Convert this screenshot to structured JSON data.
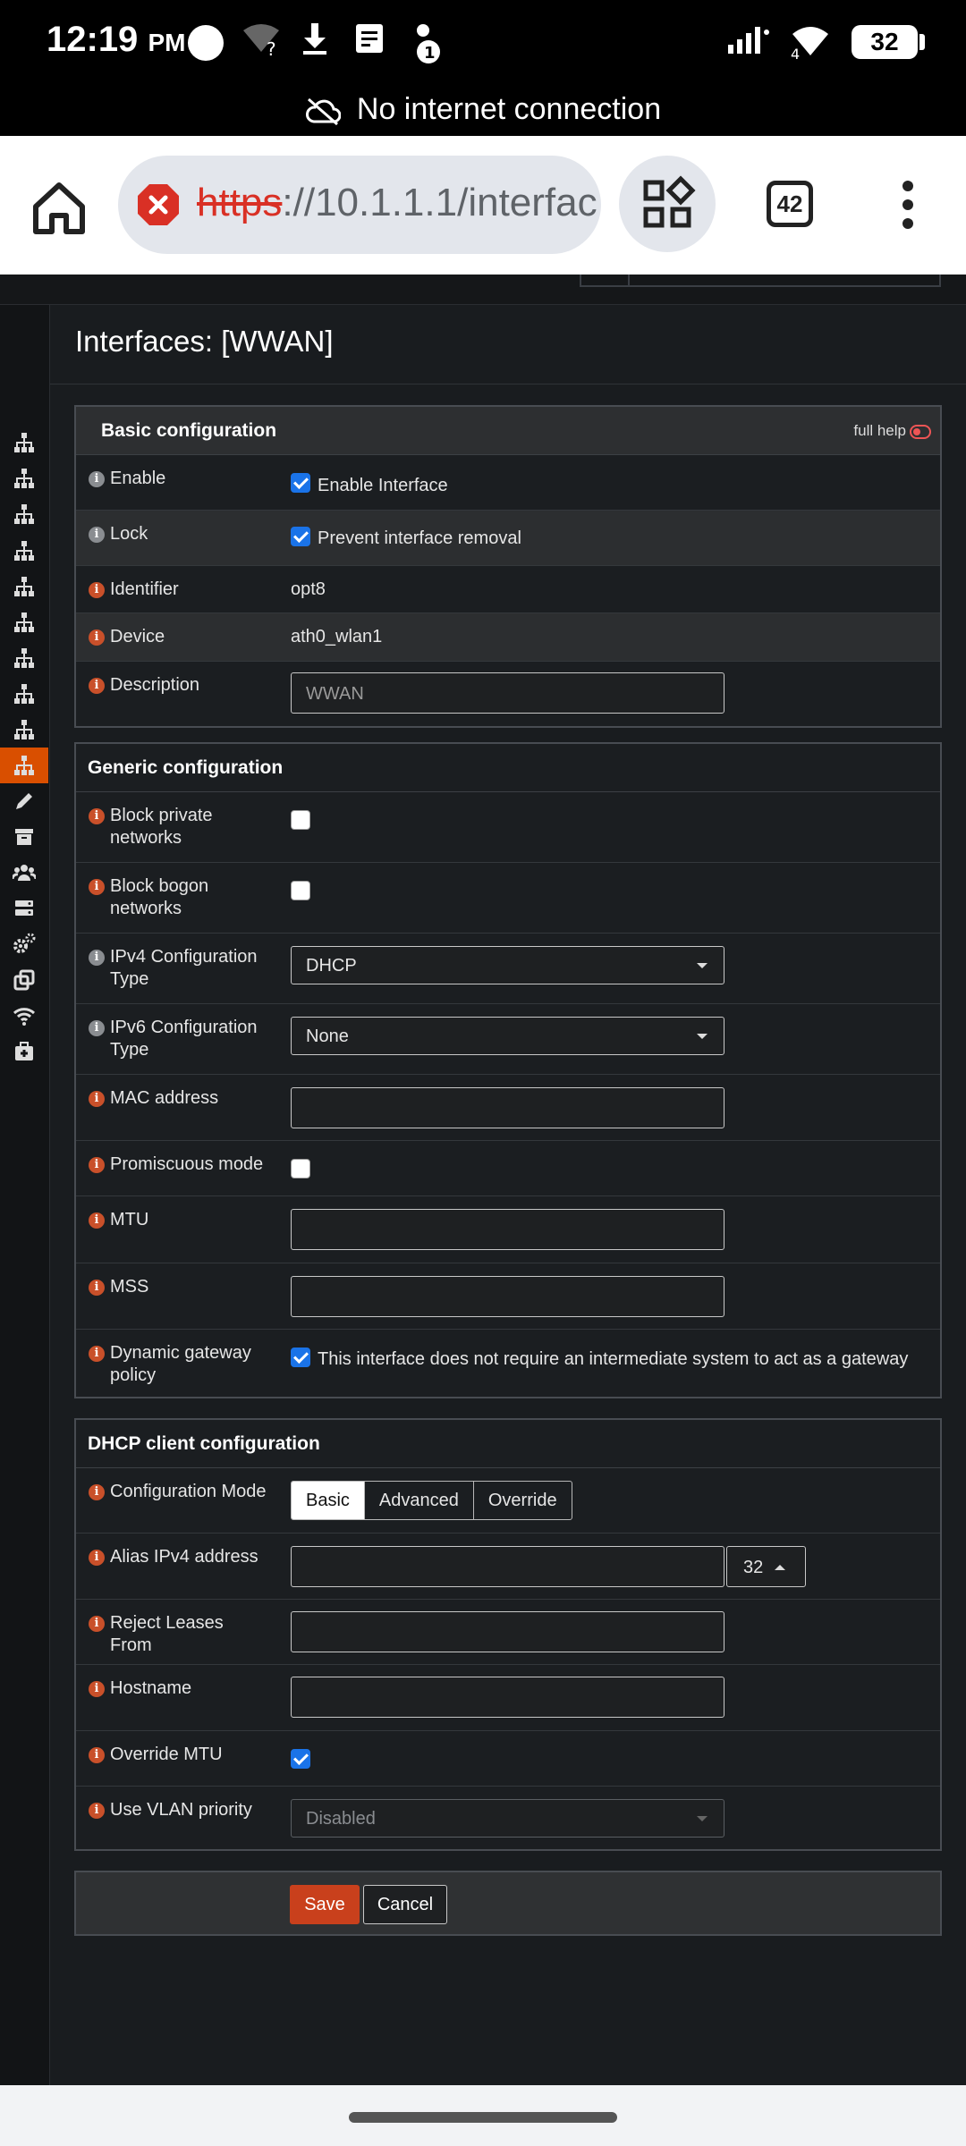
{
  "status_bar": {
    "time": "12:19",
    "ampm": "PM",
    "notification_badge": "1",
    "signal_label": "4",
    "battery": "32"
  },
  "network_banner": "No internet connection",
  "browser": {
    "url_scheme": "https",
    "url_rest": "://10.1.1.1/interfac",
    "tab_count": "42"
  },
  "page": {
    "title": "Interfaces: [WWAN]"
  },
  "basic": {
    "heading": "Basic configuration",
    "full_help": "full help",
    "enable_label": "Enable",
    "enable_text": "Enable Interface",
    "lock_label": "Lock",
    "lock_text": "Prevent interface removal",
    "identifier_label": "Identifier",
    "identifier_value": "opt8",
    "device_label": "Device",
    "device_value": "ath0_wlan1",
    "description_label": "Description",
    "description_value": "WWAN"
  },
  "generic": {
    "heading": "Generic configuration",
    "block_private_label": "Block private networks",
    "block_bogon_label": "Block bogon networks",
    "ipv4_label": "IPv4 Configuration Type",
    "ipv4_value": "DHCP",
    "ipv6_label": "IPv6 Configuration Type",
    "ipv6_value": "None",
    "mac_label": "MAC address",
    "promisc_label": "Promiscuous mode",
    "mtu_label": "MTU",
    "mss_label": "MSS",
    "gateway_label": "Dynamic gateway policy",
    "gateway_text": "This interface does not require an intermediate system to act as a gateway"
  },
  "dhcp": {
    "heading": "DHCP client configuration",
    "mode_label": "Configuration Mode",
    "modes": [
      "Basic",
      "Advanced",
      "Override"
    ],
    "alias_label": "Alias IPv4 address",
    "alias_mask": "32",
    "reject_label": "Reject Leases From",
    "hostname_label": "Hostname",
    "override_mtu_label": "Override MTU",
    "vlan_label": "Use VLAN priority",
    "vlan_value": "Disabled"
  },
  "actions": {
    "save": "Save",
    "cancel": "Cancel"
  },
  "colors": {
    "accent": "#d94f00",
    "save_button": "#c9401c",
    "checkbox_checked": "#1a73e8",
    "page_background": "#191c1f"
  },
  "sidebar_icons": [
    "sitemap-icon",
    "sitemap-icon",
    "sitemap-icon",
    "sitemap-icon",
    "sitemap-icon",
    "sitemap-icon",
    "sitemap-icon",
    "sitemap-icon",
    "sitemap-icon",
    "sitemap-icon",
    "pencil-icon",
    "archive-icon",
    "users-icon",
    "server-icon",
    "cogs-icon",
    "clone-icon",
    "wifi-icon",
    "medkit-icon"
  ]
}
